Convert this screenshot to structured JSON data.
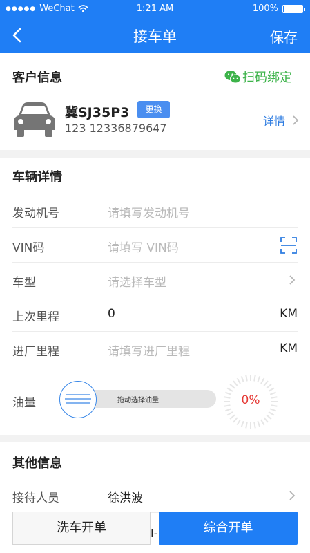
{
  "status_bar": {
    "carrier": "WeChat",
    "time": "1:21 AM",
    "battery": "100%"
  },
  "nav": {
    "title": "接车单",
    "save": "保存"
  },
  "customer": {
    "section_title": "客户信息",
    "scan_bind": "扫码绑定",
    "plate": "冀SJ35P3",
    "change": "更换",
    "phone": "123 12336879647",
    "detail": "详情"
  },
  "vehicle": {
    "section_title": "车辆详情",
    "engine": {
      "label": "发动机号",
      "placeholder": "请填写发动机号"
    },
    "vin": {
      "label": "VIN码",
      "placeholder": "请填写 VIN码"
    },
    "model": {
      "label": "车型",
      "placeholder": "请选择车型"
    },
    "last_mileage": {
      "label": "上次里程",
      "value": "0",
      "unit": "KM"
    },
    "entry_mileage": {
      "label": "进厂里程",
      "placeholder": "请填写进厂里程",
      "unit": "KM"
    },
    "fuel": {
      "label": "油量",
      "hint": "拖动选择油量",
      "percent": "0%",
      "level": 0
    }
  },
  "other": {
    "section_title": "其他信息",
    "receptionist": {
      "label": "接待人员",
      "value": "徐洪波"
    }
  },
  "buttons": {
    "wash": "洗车开单",
    "main": "综合开单",
    "peek_text": "I-"
  },
  "colors": {
    "primary": "#1f7ef5",
    "wechat_green": "#3db34a",
    "link_blue": "#2f7de1",
    "danger": "#e53935"
  }
}
